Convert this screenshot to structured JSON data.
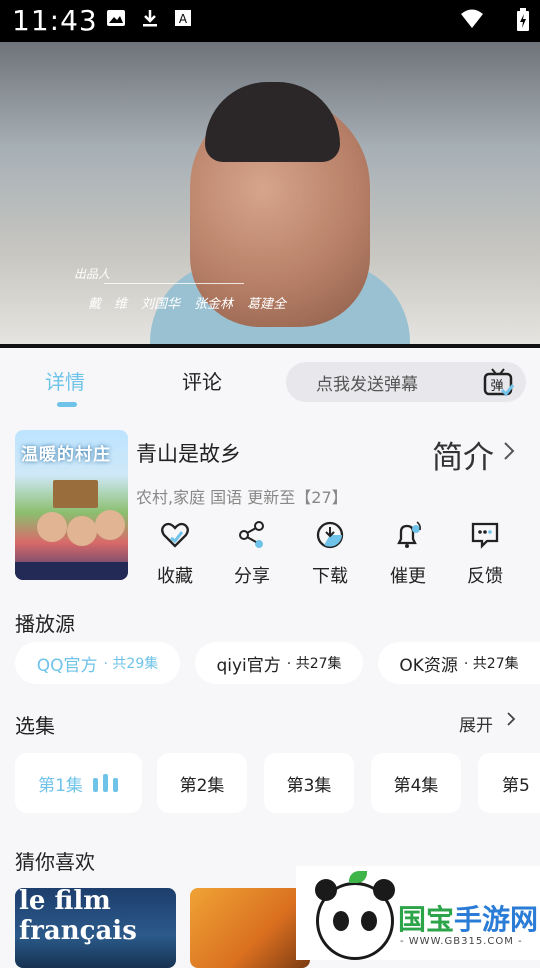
{
  "status_bar": {
    "time": "11:43",
    "left_icons": [
      "image-icon",
      "download-icon",
      "a-icon"
    ],
    "right_icons": [
      "wifi-icon",
      "battery-charging-icon"
    ]
  },
  "video": {
    "credits_title": "出品人",
    "credits_names": [
      "戴　维",
      "刘国华",
      "张金林",
      "葛建全"
    ]
  },
  "tabs": {
    "items": [
      {
        "label": "详情",
        "active": true
      },
      {
        "label": "评论",
        "active": false
      }
    ],
    "danmu_placeholder": "点我发送弹幕",
    "danmu_badge": "弹"
  },
  "show": {
    "poster_title": "温暖的村庄",
    "title": "青山是故乡",
    "intro_label": "简介",
    "meta": "农村,家庭 国语 更新至【27】",
    "actions": [
      {
        "label": "收藏",
        "icon": "heart-icon"
      },
      {
        "label": "分享",
        "icon": "share-icon"
      },
      {
        "label": "下载",
        "icon": "download-clock-icon"
      },
      {
        "label": "催更",
        "icon": "bell-icon"
      },
      {
        "label": "反馈",
        "icon": "feedback-icon"
      }
    ]
  },
  "sources": {
    "heading": "播放源",
    "items": [
      {
        "name": "QQ官方",
        "count": "· 共29集",
        "active": true
      },
      {
        "name": "qiyi官方",
        "count": "· 共27集",
        "active": false
      },
      {
        "name": "OK资源",
        "count": "· 共27集",
        "active": false
      }
    ]
  },
  "episodes": {
    "heading": "选集",
    "expand_label": "展开",
    "items": [
      {
        "label": "第1集",
        "active": true
      },
      {
        "label": "第2集",
        "active": false
      },
      {
        "label": "第3集",
        "active": false
      },
      {
        "label": "第4集",
        "active": false
      },
      {
        "label": "第5",
        "active": false
      }
    ]
  },
  "recommend": {
    "heading": "猜你喜欢",
    "items": [
      {
        "title": "le film français"
      },
      {
        "title": ""
      }
    ]
  },
  "watermark": {
    "brand_part1": "国宝",
    "brand_part2": "手游网",
    "url": "- WWW.GB315.COM -"
  },
  "colors": {
    "accent": "#6fc3e8",
    "background": "#f7f7f9",
    "statusbar": "#000000"
  }
}
